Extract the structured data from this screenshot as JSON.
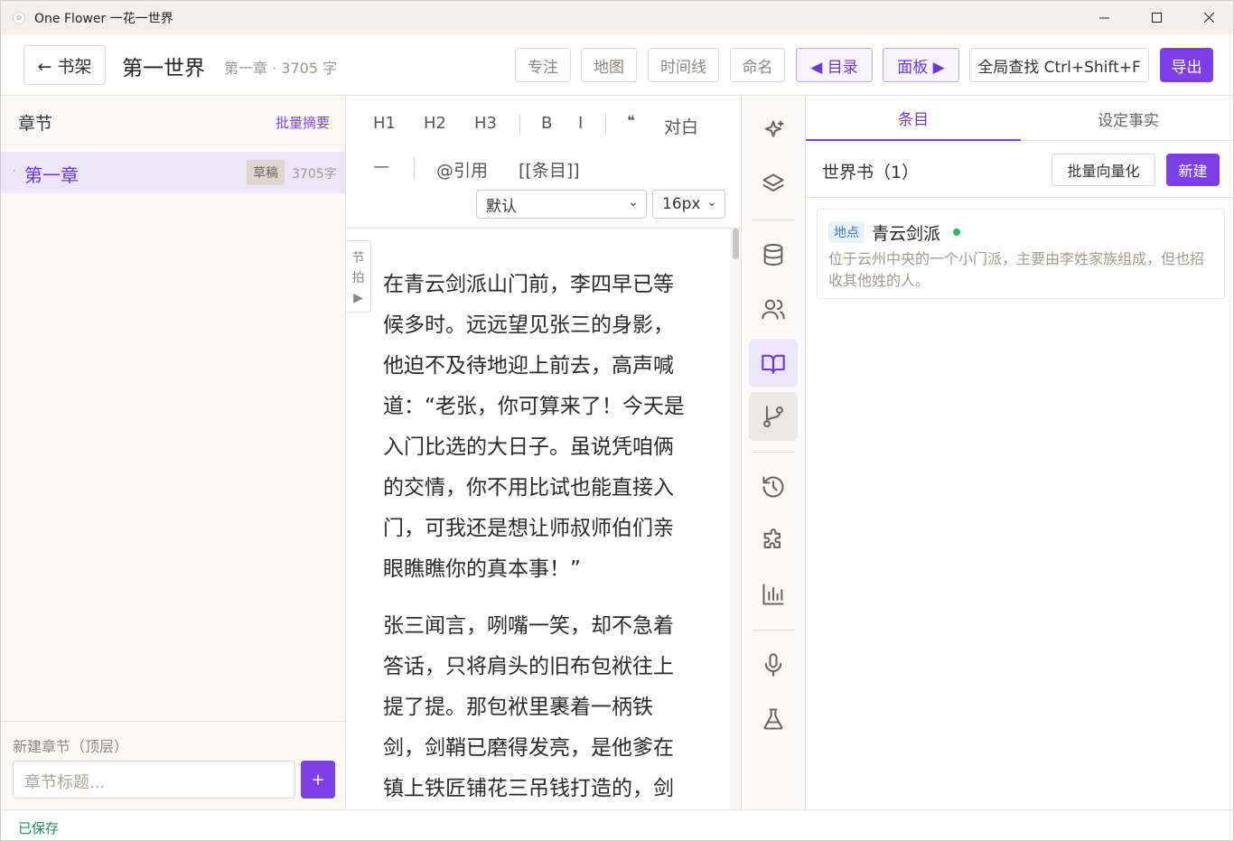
{
  "window": {
    "title": "One Flower 一花一世界",
    "minimize": "—",
    "maximize": "☐",
    "close": "✕"
  },
  "header": {
    "back_label": "← 书架",
    "book_title": "第一世界",
    "chapter_meta": "第一章 · 3705 字",
    "buttons": {
      "focus": "专注",
      "map": "地图",
      "timeline": "时间线",
      "naming": "命名",
      "toc": "◀ 目录",
      "panel": "面板 ▶",
      "global_search": "全局查找 Ctrl+Shift+F",
      "export": "导出"
    }
  },
  "sidebar": {
    "title": "章节",
    "batch_summary": "批量摘要",
    "chapters": [
      {
        "name": "第一章",
        "status": "草稿",
        "words": "3705字"
      }
    ],
    "new_chapter_label": "新建章节（顶层）",
    "new_chapter_placeholder": "章节标题...",
    "add_button": "+"
  },
  "editor": {
    "toolbar": {
      "h1": "H1",
      "h2": "H2",
      "h3": "H3",
      "bold": "B",
      "italic": "I",
      "quote": "❝",
      "dialogue": "对白",
      "hr": "—",
      "cite": "@引用",
      "entry_link": "[[条目]]",
      "font_select": "默认",
      "size_select": "16px"
    },
    "beat_tab": [
      "节",
      "拍",
      "▶"
    ],
    "paragraphs": [
      [
        "在青云剑派山门前，李四早已等",
        "候多时。远远望见张三的身影，",
        "他迫不及待地迎上前去，高声喊",
        "道：“老张，你可算来了！今天是",
        "入门比选的大日子。虽说凭咱俩",
        "的交情，你不用比试也能直接入",
        "门，可我还是想让师叔师伯们亲",
        "眼瞧瞧你的真本事！”"
      ],
      [
        "张三闻言，咧嘴一笑，却不急着",
        "答话，只将肩头的旧布包袱往上",
        "提了提。那包袱里裹着一柄铁",
        "剑，剑鞘已磨得发亮，是他爹在",
        "镇上铁匠铺花三吊钱打造的，剑"
      ]
    ]
  },
  "rail": {
    "icons": [
      "sparkles-icon",
      "layers-icon",
      "database-icon",
      "users-icon",
      "book-open-icon",
      "git-branch-icon",
      "history-icon",
      "puzzle-icon",
      "bar-chart-icon",
      "microphone-icon",
      "flask-icon"
    ],
    "active": "book-open-icon"
  },
  "panel": {
    "tabs": [
      "条目",
      "设定事实"
    ],
    "active_tab": 0,
    "worldbook_title": "世界书（1）",
    "batch_vectorize": "批量向量化",
    "new_button": "新建",
    "entries": [
      {
        "tag": "地点",
        "name": "青云剑派",
        "description": "位于云州中央的一个小门派，主要由李姓家族组成，但也招收其他姓的人。",
        "status_color": "#1fb86c"
      }
    ]
  },
  "status_bar": {
    "text": "已保存"
  },
  "colors": {
    "accent": "#7e3fe8",
    "saved": "#1e8f57"
  }
}
